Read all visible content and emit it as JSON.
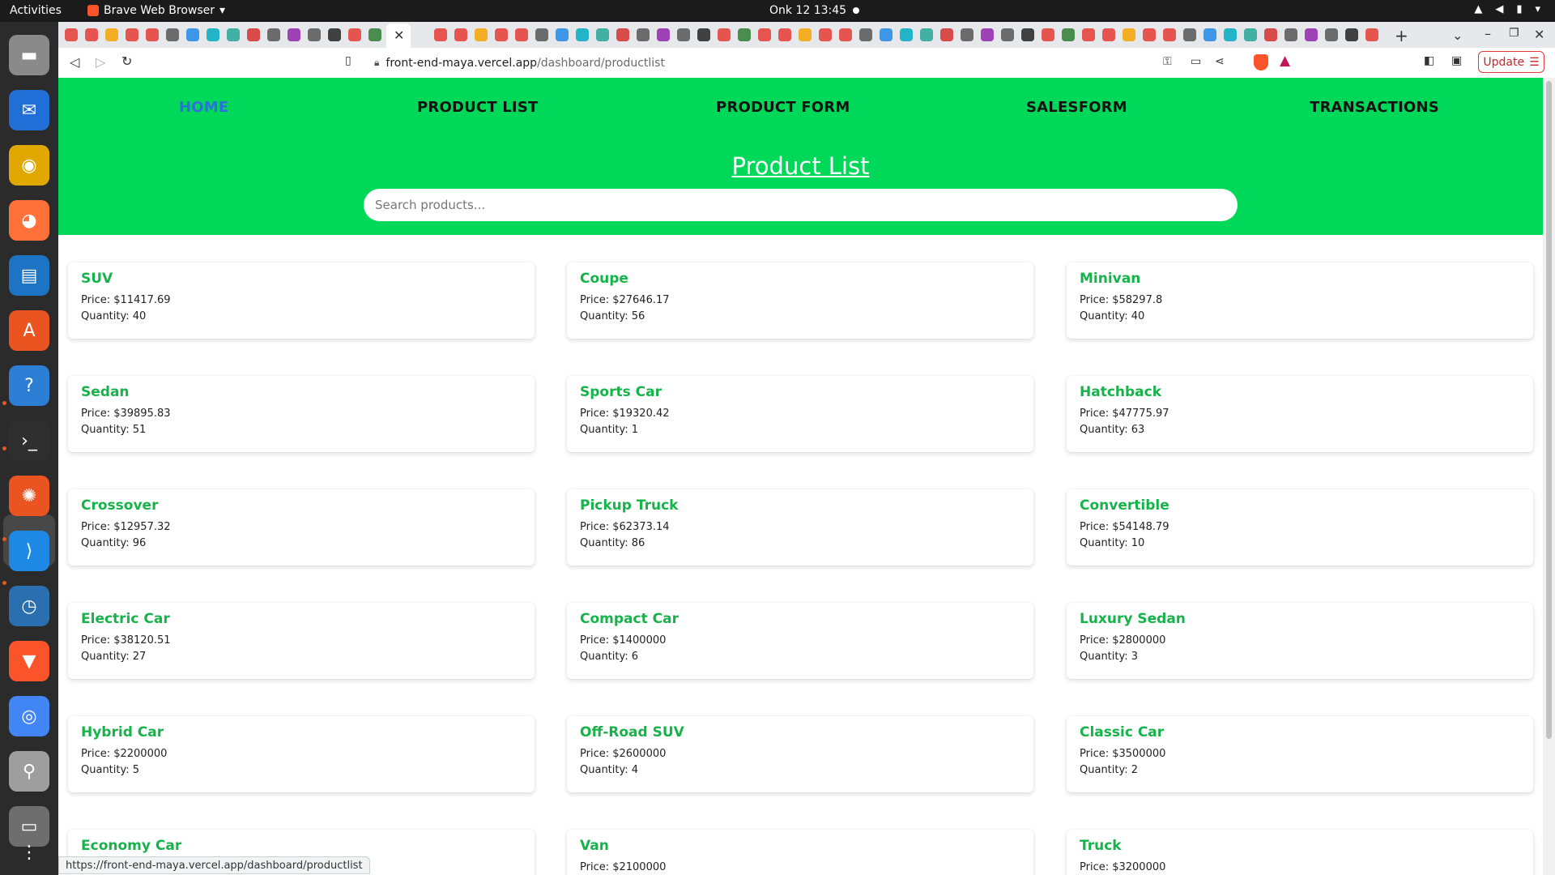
{
  "system_bar": {
    "activities": "Activities",
    "app_name": "Brave Web Browser",
    "clock": "Onk 12  13:45"
  },
  "dock": {
    "items": [
      {
        "name": "files-icon",
        "color": "#8a8a8a"
      },
      {
        "name": "thunderbird-icon",
        "color": "#1f6fd6"
      },
      {
        "name": "rhythmbox-icon",
        "color": "#e0a800"
      },
      {
        "name": "firefox-icon",
        "color": "#ff7139"
      },
      {
        "name": "libreoffice-writer-icon",
        "color": "#1e74c4"
      },
      {
        "name": "app-center-icon",
        "color": "#e95420"
      },
      {
        "name": "help-icon",
        "color": "#2d7fd6"
      },
      {
        "name": "terminal-icon",
        "color": "#2f2f2f"
      },
      {
        "name": "ubuntu-icon",
        "color": "#e95420"
      },
      {
        "name": "vscode-icon",
        "color": "#1e88e5"
      },
      {
        "name": "timer-icon",
        "color": "#2a6fb0"
      },
      {
        "name": "brave-icon",
        "color": "#fb542b"
      },
      {
        "name": "chrome-icon",
        "color": "#4285f4"
      },
      {
        "name": "magnifier-icon",
        "color": "#9e9e9e"
      },
      {
        "name": "storage-icon",
        "color": "#6e6e6e"
      },
      {
        "name": "app-grid-icon",
        "color": "#2b2b2b"
      }
    ]
  },
  "browser": {
    "url_host": "front-end-maya.vercel.app",
    "url_path": "/dashboard/productlist",
    "update_label": "Update",
    "status_url": "https://front-end-maya.vercel.app/dashboard/productlist"
  },
  "page": {
    "nav": {
      "home": "HOME",
      "product_list": "PRODUCT LIST",
      "product_form": "PRODUCT FORM",
      "salesform": "SALESFORM",
      "transactions": "TRANSACTIONS"
    },
    "title": "Product List",
    "search_placeholder": "Search products...",
    "products": [
      {
        "name": "SUV",
        "price": "Price: $11417.69",
        "quantity": "Quantity: 40"
      },
      {
        "name": "Coupe",
        "price": "Price: $27646.17",
        "quantity": "Quantity: 56"
      },
      {
        "name": "Minivan",
        "price": "Price: $58297.8",
        "quantity": "Quantity: 40"
      },
      {
        "name": "Sedan",
        "price": "Price: $39895.83",
        "quantity": "Quantity: 51"
      },
      {
        "name": "Sports Car",
        "price": "Price: $19320.42",
        "quantity": "Quantity: 1"
      },
      {
        "name": "Hatchback",
        "price": "Price: $47775.97",
        "quantity": "Quantity: 63"
      },
      {
        "name": "Crossover",
        "price": "Price: $12957.32",
        "quantity": "Quantity: 96"
      },
      {
        "name": "Pickup Truck",
        "price": "Price: $62373.14",
        "quantity": "Quantity: 86"
      },
      {
        "name": "Convertible",
        "price": "Price: $54148.79",
        "quantity": "Quantity: 10"
      },
      {
        "name": "Electric Car",
        "price": "Price: $38120.51",
        "quantity": "Quantity: 27"
      },
      {
        "name": "Compact Car",
        "price": "Price: $1400000",
        "quantity": "Quantity: 6"
      },
      {
        "name": "Luxury Sedan",
        "price": "Price: $2800000",
        "quantity": "Quantity: 3"
      },
      {
        "name": "Hybrid Car",
        "price": "Price: $2200000",
        "quantity": "Quantity: 5"
      },
      {
        "name": "Off-Road SUV",
        "price": "Price: $2600000",
        "quantity": "Quantity: 4"
      },
      {
        "name": "Classic Car",
        "price": "Price: $3500000",
        "quantity": "Quantity: 2"
      },
      {
        "name": "Economy Car",
        "price": "",
        "quantity": ""
      },
      {
        "name": "Van",
        "price": "Price: $2100000",
        "quantity": ""
      },
      {
        "name": "Truck",
        "price": "Price: $3200000",
        "quantity": ""
      }
    ]
  },
  "colors": {
    "hero_green": "#00d85a",
    "product_name_green": "#16b34a",
    "active_nav_blue": "#2f6fe0",
    "update_red": "#c62828"
  }
}
